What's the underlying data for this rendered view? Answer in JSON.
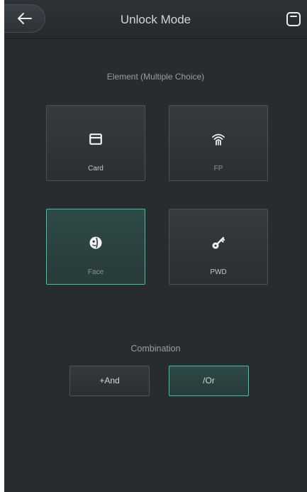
{
  "header": {
    "title": "Unlock Mode",
    "back_icon": "arrow-left-icon",
    "save_icon": "save-icon"
  },
  "elements": {
    "label": "Element (Multiple Choice)",
    "items": [
      {
        "label": "Card",
        "icon": "card-icon",
        "selected": false
      },
      {
        "label": "FP",
        "icon": "fingerprint-icon",
        "selected": false
      },
      {
        "label": "Face",
        "icon": "face-icon",
        "selected": true
      },
      {
        "label": "PWD",
        "icon": "key-icon",
        "selected": false
      }
    ]
  },
  "combination": {
    "label": "Combination",
    "options": [
      {
        "label": "+And",
        "selected": false
      },
      {
        "label": "/Or",
        "selected": true
      }
    ]
  },
  "colors": {
    "background": "#282c2f",
    "accent": "#41bfae",
    "text": "#d4d6d8"
  }
}
